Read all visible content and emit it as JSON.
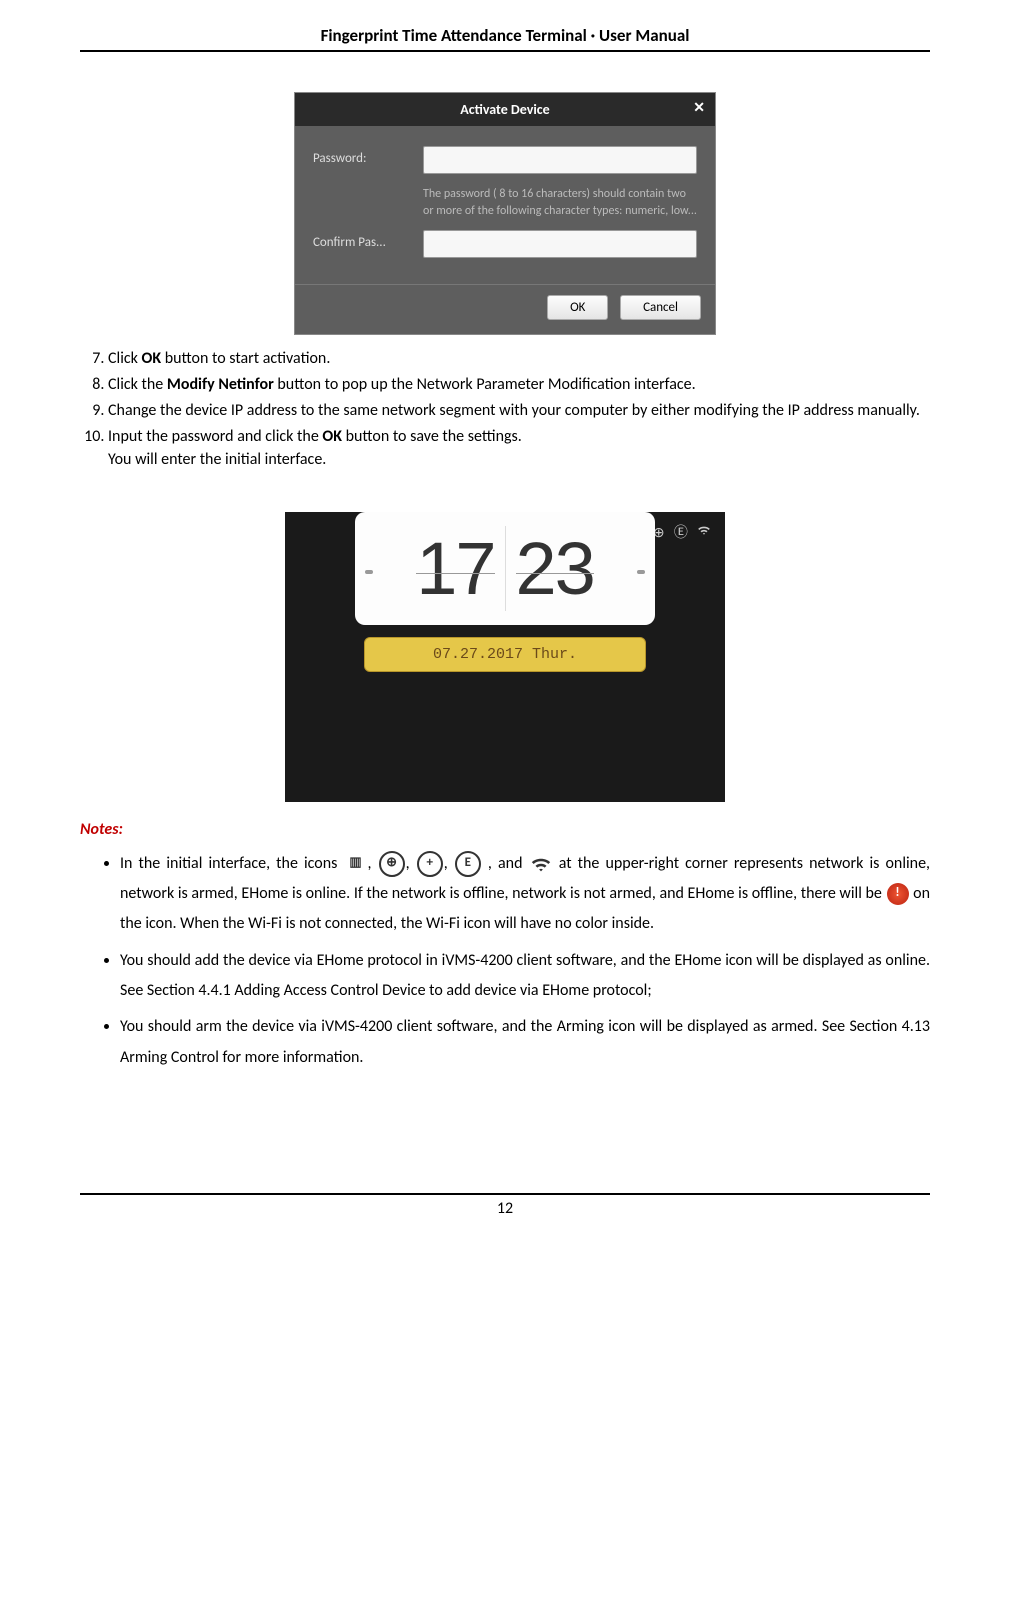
{
  "header": "Fingerprint Time Attendance Terminal · User Manual",
  "dialog": {
    "title": "Activate Device",
    "password_label": "Password:",
    "hint": "The password ( 8 to 16 characters) should contain two or more of the following character types: numeric, low...",
    "confirm_label": "Confirm Pas...",
    "ok": "OK",
    "cancel": "Cancel"
  },
  "steps": {
    "s7": "Click <b>OK</b> button to start activation.",
    "s8": "Click the <b>Modify Netinfor</b> button to pop up the Network Parameter Modification interface.",
    "s9": "Change the device IP address to the same network segment with your computer by either modifying the IP address manually.",
    "s10a": "Input the password and click the <b>OK</b> button to save the settings.",
    "s10b": "You will enter the initial interface."
  },
  "device": {
    "hour": "17",
    "minute": "23",
    "date": "07.27.2017  Thur."
  },
  "notes_heading": "Notes:",
  "notes": {
    "n1a": "In the initial interface, the icons ",
    "n1b": ", and ",
    "n1c": " at the upper-right corner represents network is online, network is armed, EHome is online. If the network is offline, network is not armed, and EHome is offline, there will be ",
    "n1d": " on the icon. When the Wi-Fi is not connected, the Wi-Fi icon will have no color inside.",
    "n2": "You should add the device via EHome protocol in iVMS-4200 client software, and the EHome icon will be displayed as online. See Section 4.4.1 Adding Access Control Device to add device via EHome protocol;",
    "n3": "You should arm the device via iVMS-4200 client software, and the Arming icon will be displayed as armed. See Section 4.13 Arming Control for more information."
  },
  "page_number": "12"
}
